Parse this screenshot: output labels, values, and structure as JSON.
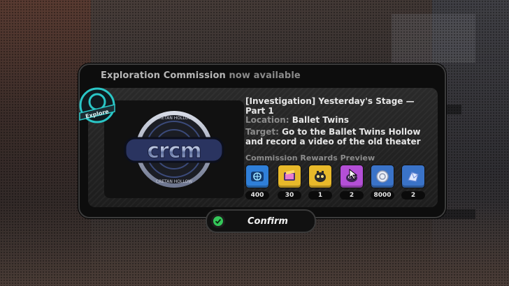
{
  "dialog": {
    "title_prefix": "Exploration Commission",
    "title_suffix": " now available",
    "mission_title": "[Investigation] Yesterday's Stage — Part 1",
    "location_key": "Location:",
    "location_value": "Ballet Twins",
    "target_key": "Target:",
    "target_value": "Go to the Ballet Twins Hollow and record a video of the old theater",
    "rewards_label": "Commission Rewards Preview",
    "rewards": [
      {
        "icon": "globe-ticket-icon",
        "count": "400",
        "color": "#2f7fd8"
      },
      {
        "icon": "film-reel-icon",
        "count": "30",
        "color": "#e8b92a"
      },
      {
        "icon": "bangboo-icon",
        "count": "1",
        "color": "#e8b92a"
      },
      {
        "icon": "bangboo-material-icon",
        "count": "2",
        "color": "#b44fd6"
      },
      {
        "icon": "dennies-coin-icon",
        "count": "8000",
        "color": "#3a73c8"
      },
      {
        "icon": "crystal-shard-icon",
        "count": "2",
        "color": "#3a73c8"
      }
    ],
    "badge_text": "Explore",
    "logo_text": "CRCM",
    "logo_ring_text": "CRETAN HOLLOW"
  },
  "confirm_button": {
    "label": "Confirm",
    "accent": "#34c759"
  }
}
